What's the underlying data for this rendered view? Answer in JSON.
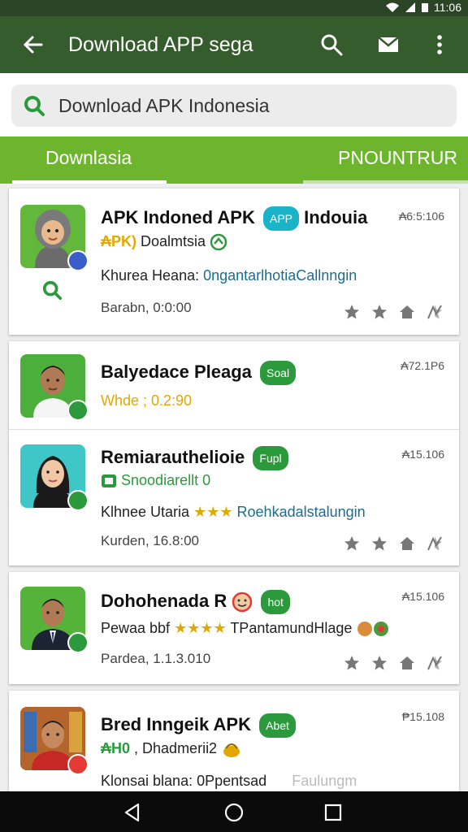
{
  "status_bar": {
    "time": "11:06"
  },
  "app_bar": {
    "title": "Download APP sega"
  },
  "search": {
    "text": "Download APK Indonesia"
  },
  "tabs": [
    {
      "label": "Downlasia"
    },
    {
      "label": "PNOUNTRUR"
    }
  ],
  "items": [
    {
      "name": "APK Indoned APK",
      "pill": "APP",
      "pill_color": "#1bb3c7",
      "extra": "Indouia",
      "size": "₳6:5:106",
      "sub_prefix": "₳PK)",
      "sub_text": "Doalmtsia",
      "desc_label": "Khurea Heana:",
      "desc_link": "0ngantarlhotiaCallnngin",
      "date": "Barabn, 0:0:00"
    },
    {
      "name": "Balyedace Pleaga",
      "pill": "Soal",
      "pill_color": "#2c9a3c",
      "size": "₳72.1P6",
      "sub_text": "Whde ; 0.2:90"
    },
    {
      "name": "Remiarauthelioie",
      "pill": "Fupl",
      "pill_color": "#2c9a3c",
      "size": "₳15.106",
      "sub_text": "Snoodiarellt 0",
      "desc_label": "Klhnee Utaria",
      "desc_stars": "★★★",
      "desc_link": "Roehkadalstalungin",
      "date": "Kurden, 16.8:00"
    },
    {
      "name": "Dohohenada R",
      "pill": "hot",
      "pill_color": "#2c9a3c",
      "size": "₳15.106",
      "desc_label": "Pewaa bbf",
      "desc_stars": "★★★★",
      "desc_text": "TPantamundHlage",
      "date": "Pardea, 1.1.3.010"
    },
    {
      "name": "Bred Inngeik APK",
      "pill": "Abet",
      "pill_color": "#2c9a3c",
      "size": "₱15.108",
      "sub_prefix": "₳H0",
      "sub_text": ", Dhadmerii2",
      "desc_label": "Klonsai blana:",
      "desc_text": "0Ppentsad",
      "desc_faint": "Faulungm"
    }
  ],
  "icons": {
    "back": "arrow-left-icon",
    "search": "search-icon",
    "mail": "mail-icon",
    "more": "more-vert-icon",
    "actions": [
      "star-icon",
      "star-icon",
      "home-icon",
      "share-icon"
    ],
    "nav": [
      "back-triangle-icon",
      "home-circle-icon",
      "recents-square-icon"
    ]
  },
  "colors": {
    "status_bar": "#2c4426",
    "app_bar": "#355c2c",
    "tab_bar": "#6cb52d",
    "accent_green": "#2c9a3c",
    "link": "#1b6d8e",
    "star_gold": "#e0a800"
  }
}
